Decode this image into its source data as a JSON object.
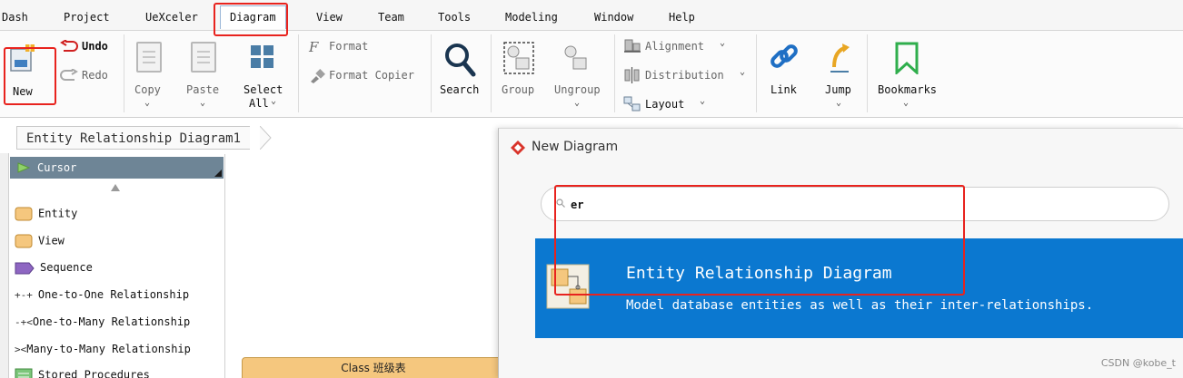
{
  "menubar": {
    "items": [
      "Dash",
      "Project",
      "UeXceler",
      "Diagram",
      "View",
      "Team",
      "Tools",
      "Modeling",
      "Window",
      "Help"
    ],
    "active": "Diagram"
  },
  "ribbon": {
    "new": "New",
    "undo": "Undo",
    "redo": "Redo",
    "copy": "Copy",
    "paste": "Paste",
    "select_all_line1": "Select",
    "select_all_line2": "All",
    "format": "Format",
    "format_copier": "Format Copier",
    "search": "Search",
    "group": "Group",
    "ungroup": "Ungroup",
    "alignment": "Alignment",
    "distribution": "Distribution",
    "layout": "Layout",
    "link": "Link",
    "jump": "Jump",
    "bookmarks": "Bookmarks"
  },
  "diagram_tab": {
    "title": "Entity Relationship Diagram1"
  },
  "palette": {
    "cursor": "Cursor",
    "items": [
      "Entity",
      "View",
      "Sequence",
      "One-to-One Relationship",
      "One-to-Many Relationship",
      "Many-to-Many Relationship",
      "Stored Procedures"
    ]
  },
  "canvas": {
    "class_box_title": "Class 班级表"
  },
  "dialog": {
    "title": "New Diagram",
    "search_value": "er",
    "result": {
      "title": "Entity Relationship Diagram",
      "description": "Model database entities as well as their inter-relationships."
    },
    "watermark": "CSDN @kobe_t"
  },
  "colors": {
    "highlight": "#0b78d0",
    "annotation": "#e8231e",
    "entity_fill": "#f5c77e",
    "palette_selected": "#6e8596"
  }
}
